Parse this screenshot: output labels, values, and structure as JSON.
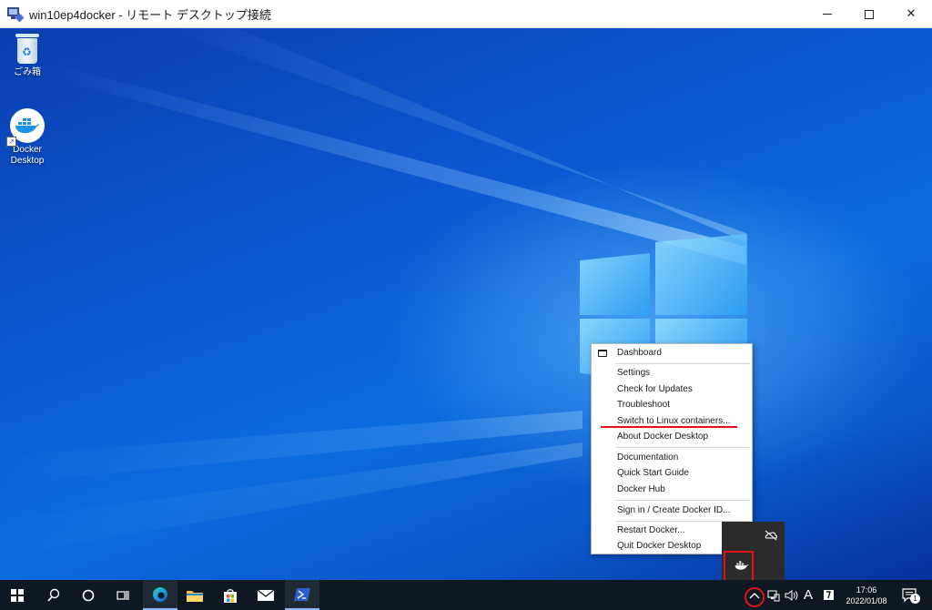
{
  "window": {
    "title": "win10ep4docker - リモート デスクトップ接続",
    "minimize_label": "—",
    "maximize_label": "☐",
    "close_label": "✕"
  },
  "desktop": {
    "icons": [
      {
        "name": "recycle-bin",
        "label": "ごみ箱"
      },
      {
        "name": "docker-desktop",
        "label_line1": "Docker",
        "label_line2": "Desktop"
      }
    ]
  },
  "context_menu": {
    "items": [
      {
        "label": "Dashboard"
      },
      {
        "label": "Settings"
      },
      {
        "label": "Check for Updates"
      },
      {
        "label": "Troubleshoot"
      },
      {
        "label": "Switch to Linux containers..."
      },
      {
        "label": "About Docker Desktop"
      },
      {
        "label": "Documentation"
      },
      {
        "label": "Quick Start Guide"
      },
      {
        "label": "Docker Hub"
      },
      {
        "label": "Sign in / Create Docker ID..."
      },
      {
        "label": "Restart Docker..."
      },
      {
        "label": "Quit Docker Desktop"
      }
    ]
  },
  "tray": {
    "ime_label": "A",
    "time": "17:06",
    "date": "2022/01/08",
    "notification_count": "1"
  },
  "colors": {
    "highlight_red": "#e3111a",
    "taskbar_bg": "#0e1822",
    "docker_blue": "#1d91e6"
  }
}
